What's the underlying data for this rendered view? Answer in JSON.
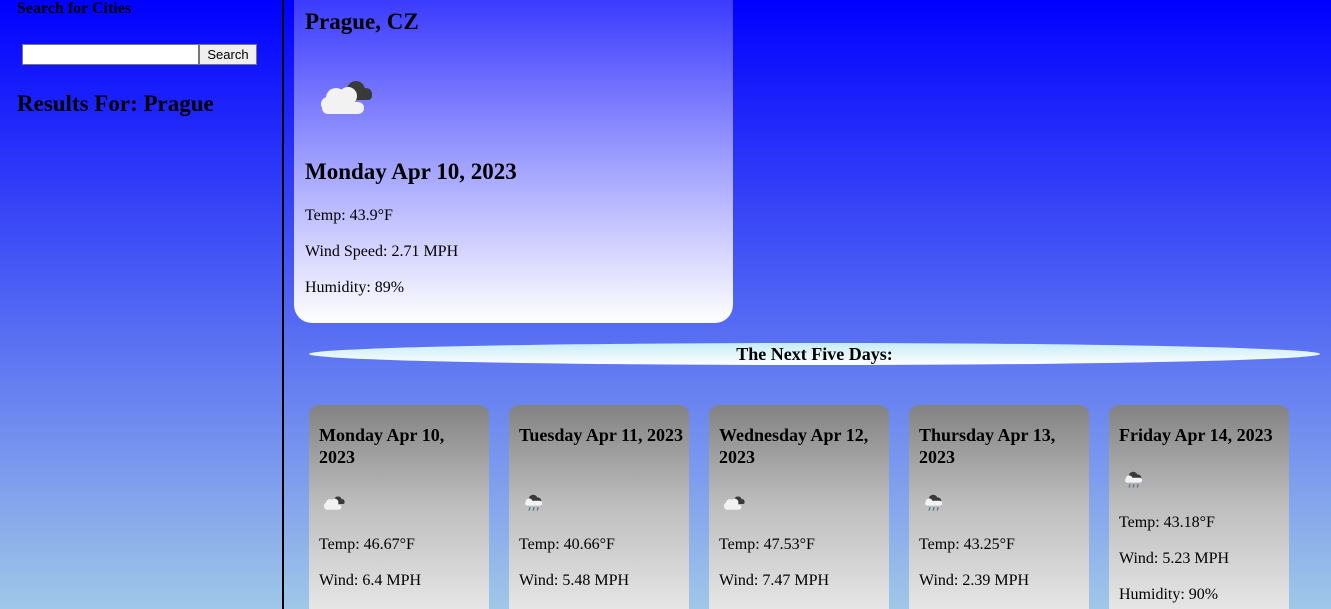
{
  "sidebar": {
    "heading": "Search for Cities",
    "search_placeholder": "",
    "search_button": "Search",
    "results_label": "Results For: Prague"
  },
  "current": {
    "city": "Prague, CZ",
    "icon": "broken-clouds-icon",
    "date": "Monday Apr 10, 2023",
    "temp": "Temp: 43.9°F",
    "wind": "Wind Speed: 2.71 MPH",
    "humidity": "Humidity: 89%"
  },
  "forecast": {
    "heading": "The Next Five Days:",
    "days": [
      {
        "date": "Monday Apr 10, 2023",
        "icon": "broken-clouds-icon",
        "temp": "Temp: 46.67°F",
        "wind": "Wind: 6.4 MPH"
      },
      {
        "date": "Tuesday Apr 11, 2023",
        "icon": "rain-cloud-icon",
        "temp": "Temp: 40.66°F",
        "wind": "Wind: 5.48 MPH"
      },
      {
        "date": "Wednesday Apr 12, 2023",
        "icon": "broken-clouds-icon",
        "temp": "Temp: 47.53°F",
        "wind": "Wind: 7.47 MPH"
      },
      {
        "date": "Thursday Apr 13, 2023",
        "icon": "rain-cloud-icon",
        "temp": "Temp: 43.25°F",
        "wind": "Wind: 2.39 MPH"
      },
      {
        "date": "Friday Apr 14, 2023",
        "icon": "rain-cloud-icon",
        "temp": "Temp: 43.18°F",
        "wind": "Wind: 5.23 MPH",
        "humidity": "Humidity: 90%"
      }
    ]
  },
  "colors": {
    "background_top": "#0000ff",
    "background_bottom": "#a0c8e8"
  }
}
